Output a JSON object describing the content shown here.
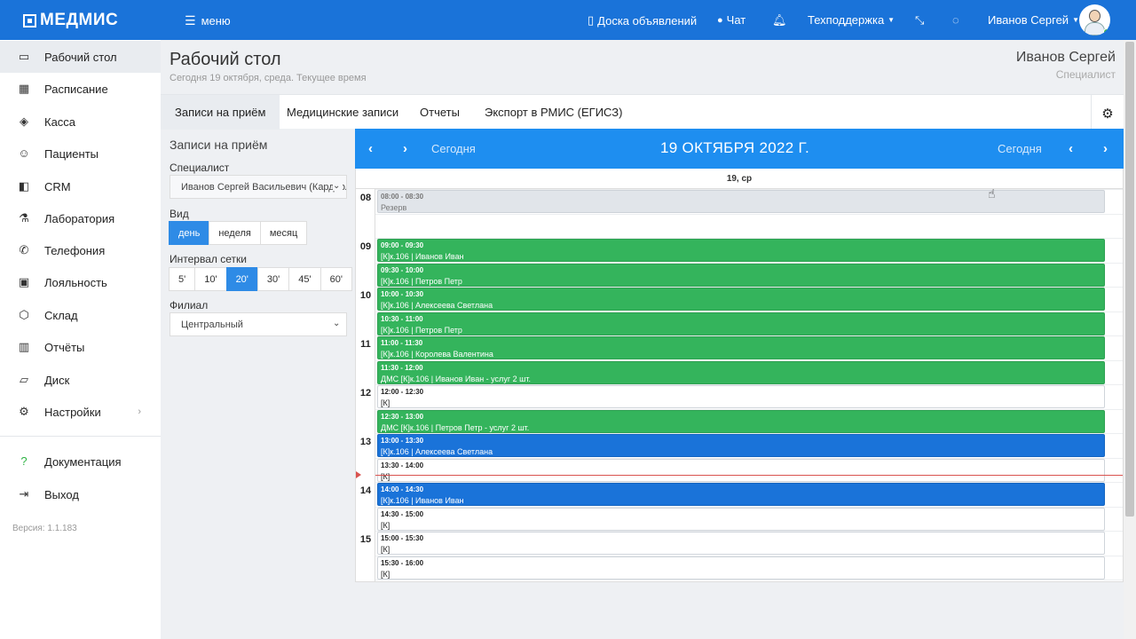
{
  "topbar": {
    "logo": "МЕДМИС",
    "menu_label": "меню",
    "board_label": "Доска объявлений",
    "chat_label": "Чат",
    "support_label": "Техподдержка",
    "user_label": "Иванов Сергей"
  },
  "sidebar": {
    "items": [
      {
        "label": "Рабочий стол",
        "icon": "monitor-icon"
      },
      {
        "label": "Расписание",
        "icon": "calendar-icon"
      },
      {
        "label": "Касса",
        "icon": "cash-icon"
      },
      {
        "label": "Пациенты",
        "icon": "users-icon"
      },
      {
        "label": "CRM",
        "icon": "crm-icon"
      },
      {
        "label": "Лаборатория",
        "icon": "flask-icon"
      },
      {
        "label": "Телефония",
        "icon": "phone-icon"
      },
      {
        "label": "Лояльность",
        "icon": "gift-icon"
      },
      {
        "label": "Склад",
        "icon": "box-icon"
      },
      {
        "label": "Отчёты",
        "icon": "bar-chart-icon"
      },
      {
        "label": "Диск",
        "icon": "folder-icon"
      },
      {
        "label": "Настройки",
        "icon": "gear-icon"
      }
    ],
    "docs_label": "Документация",
    "exit_label": "Выход",
    "version": "Версия: 1.1.183"
  },
  "header": {
    "title": "Рабочий стол",
    "subtitle": "Сегодня 19 октября, среда. Текущее время",
    "user_name": "Иванов Сергей",
    "user_role": "Специалист"
  },
  "tabs": [
    {
      "label": "Записи на приём"
    },
    {
      "label": "Медицинские записи"
    },
    {
      "label": "Отчеты"
    },
    {
      "label": "Экспорт в РМИС (ЕГИСЗ)"
    }
  ],
  "filters": {
    "title": "Записи на приём",
    "specialist_label": "Специалист",
    "specialist_value": "Иванов Сергей Васильевич (Кардиолог)",
    "view_label": "Вид",
    "views": [
      "день",
      "неделя",
      "месяц"
    ],
    "interval_label": "Интервал сетки",
    "intervals": [
      "5'",
      "10'",
      "20'",
      "30'",
      "45'",
      "60'"
    ],
    "branch_label": "Филиал",
    "branch_value": "Центральный"
  },
  "calendar": {
    "today_label": "Сегодня",
    "date_title": "19 ОКТЯБРЯ 2022 Г.",
    "day_label": "19, ср",
    "hours": [
      "08",
      "09",
      "10",
      "11",
      "12",
      "13",
      "14",
      "15"
    ],
    "events": [
      {
        "time": "08:00 - 08:30",
        "text": "Резерв",
        "kind": "gray"
      },
      {
        "time": "09:00 - 09:30",
        "text": "[К]к.106 | Иванов Иван",
        "kind": "green"
      },
      {
        "time": "09:30 - 10:00",
        "text": "[К]к.106 | Петров Петр",
        "kind": "green"
      },
      {
        "time": "10:00 - 10:30",
        "text": "[К]к.106 | Алексеева Светлана",
        "kind": "green"
      },
      {
        "time": "10:30 - 11:00",
        "text": "[К]к.106 | Петров Петр",
        "kind": "green"
      },
      {
        "time": "11:00 - 11:30",
        "text": "[К]к.106 | Королева Валентина",
        "kind": "green"
      },
      {
        "time": "11:30 - 12:00",
        "text": "ДМС [К]к.106 | Иванов Иван - услуг 2 шт.",
        "kind": "green"
      },
      {
        "time": "12:00 - 12:30",
        "text": "[К]",
        "kind": "white"
      },
      {
        "time": "12:30 - 13:00",
        "text": "ДМС [К]к.106 | Петров Петр - услуг 2 шт.",
        "kind": "green"
      },
      {
        "time": "13:00 - 13:30",
        "text": "[К]к.106 | Алексеева Светлана",
        "kind": "blue"
      },
      {
        "time": "13:30 - 14:00",
        "text": "[К]",
        "kind": "white"
      },
      {
        "time": "14:00 - 14:30",
        "text": "[К]к.106 | Иванов Иван",
        "kind": "blue"
      },
      {
        "time": "14:30 - 15:00",
        "text": "[К]",
        "kind": "white"
      },
      {
        "time": "15:00 - 15:30",
        "text": "[К]",
        "kind": "white"
      },
      {
        "time": "15:30 - 16:00",
        "text": "[К]",
        "kind": "white"
      }
    ]
  },
  "colors": {
    "topbar": "#1a73d9",
    "calendar_header": "#1e8ef0",
    "event_green": "#34b45c",
    "event_blue": "#1a73d9",
    "active_button": "#2e8be6"
  }
}
